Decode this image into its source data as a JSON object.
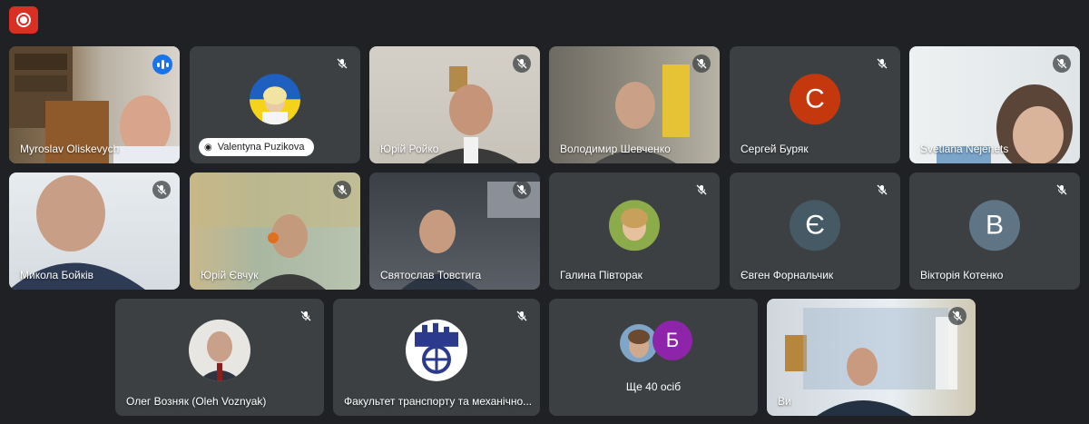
{
  "record": {
    "icon": "record-icon"
  },
  "colors": {
    "background": "#202124",
    "tile": "#3c4043",
    "accent": "#1a73e8",
    "record": "#d93025"
  },
  "tiles": [
    {
      "name": "Myroslav Oliskevych",
      "speaking": true
    },
    {
      "name": "Valentyna Puzikova",
      "muted": true
    },
    {
      "name": "Юрій Ройко",
      "muted": true
    },
    {
      "name": "Володимир Шевченко",
      "muted": true
    },
    {
      "name": "Сергей Буряк",
      "muted": true,
      "initial": "C",
      "color": "#c5380d"
    },
    {
      "name": "Svetlana Nejenets",
      "muted": true
    },
    {
      "name": "Микола Бойків",
      "muted": true
    },
    {
      "name": "Юрій Євчук",
      "muted": true
    },
    {
      "name": "Святослав Товстига",
      "muted": true
    },
    {
      "name": "Галина Півторак",
      "muted": true
    },
    {
      "name": "Євген Форнальчик",
      "muted": true,
      "initial": "Є",
      "color": "#455a64"
    },
    {
      "name": "Вікторія Котенко",
      "muted": true,
      "initial": "B",
      "color": "#5f7484"
    },
    {
      "name": "Олег Возняк (Oleh Voznyak)",
      "muted": true
    },
    {
      "name": "Факультет транспорту та механічно...",
      "muted": true
    },
    {
      "name": "Ще 40 осіб",
      "initial": "Б",
      "color": "#8e24aa"
    },
    {
      "name": "Ви",
      "muted": true
    }
  ]
}
